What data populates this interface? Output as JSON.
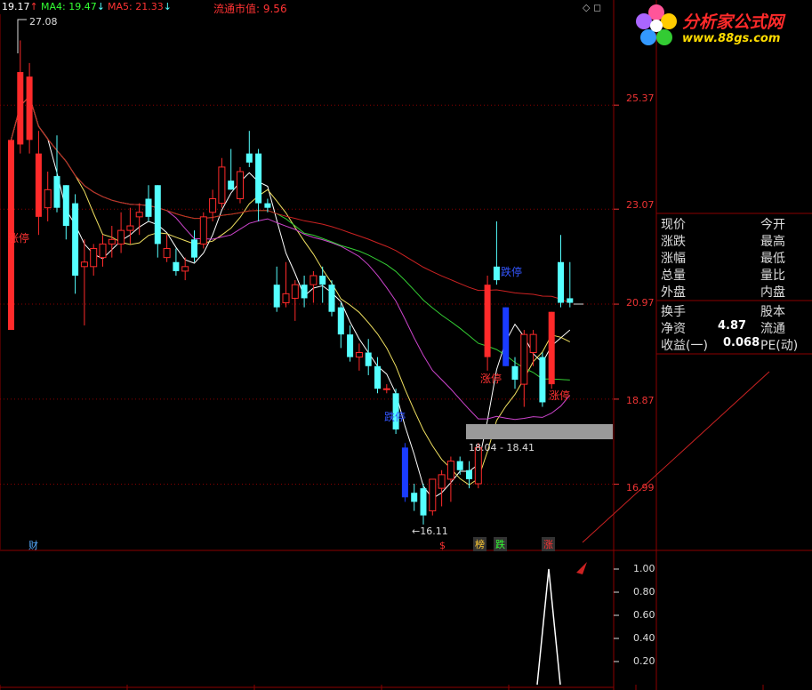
{
  "header": {
    "ma_first": "19.17",
    "ma_first_arrow": "↑",
    "ma4_label": "MA4: 19.47",
    "ma4_arrow": "↓",
    "ma5_label": "MA5: 21.33",
    "ma5_arrow": "↓",
    "market_cap_label": "流通市值: 9.56",
    "window_icons": "◇ ◻"
  },
  "logo": {
    "title": "分析家公式网",
    "url": "www.88gs.com"
  },
  "price_axis": [
    "25.37",
    "23.07",
    "20.97",
    "18.87",
    "16.99"
  ],
  "annotations": {
    "high_label": "27.08",
    "low_label": "←16.11",
    "zt_left": "涨停",
    "dt_mid": "跌停",
    "dt_right": "跌停",
    "zt_right1": "涨停",
    "zt_right2": "涨停",
    "range_label": "18.04 - 18.41",
    "cai": "财",
    "s_mark": "$",
    "bang": "榜",
    "die": "跌",
    "zhang": "涨"
  },
  "quote": {
    "rows": [
      {
        "left": "现价",
        "value": "",
        "right": "今开"
      },
      {
        "left": "涨跌",
        "value": "",
        "right": "最高"
      },
      {
        "left": "涨幅",
        "value": "",
        "right": "最低"
      },
      {
        "left": "总量",
        "value": "",
        "right": "量比"
      },
      {
        "left": "外盘",
        "value": "",
        "right": "内盘"
      },
      {
        "left": "换手",
        "value": "",
        "right": "股本"
      },
      {
        "left": "净资",
        "value": "4.87",
        "right": "流通"
      },
      {
        "left": "收益(一)",
        "value": "0.068",
        "right": "PE(动)"
      }
    ]
  },
  "sub_axis": [
    "1.00",
    "0.80",
    "0.60",
    "0.40",
    "0.20"
  ],
  "colors": {
    "up": "#ff2a2a",
    "down": "#5ff",
    "limit_down": "#1a3cff",
    "grid": "#8b0000",
    "ma_white": "#ffffff",
    "ma_yellow": "#f0e060",
    "ma_magenta": "#cc44cc",
    "ma_green": "#33cc33",
    "ma_red": "#cc2222"
  },
  "chart_data": {
    "type": "candlestick",
    "ylim": [
      15.9,
      27.3
    ],
    "candles": [
      {
        "o": 20.4,
        "h": 24.6,
        "l": 20.4,
        "c": 24.6,
        "c2": "up"
      },
      {
        "o": 24.5,
        "h": 26.8,
        "l": 24.3,
        "c": 26.1,
        "c2": "up"
      },
      {
        "o": 24.6,
        "h": 26.3,
        "l": 24.3,
        "c": 26.0,
        "c2": "up"
      },
      {
        "o": 24.3,
        "h": 24.8,
        "l": 22.5,
        "c": 22.9,
        "c2": "up"
      },
      {
        "o": 23.1,
        "h": 23.9,
        "l": 22.8,
        "c": 23.5,
        "c2": "up"
      },
      {
        "o": 23.8,
        "h": 24.7,
        "l": 23.0,
        "c": 23.1,
        "c2": "down"
      },
      {
        "o": 23.6,
        "h": 23.6,
        "l": 22.4,
        "c": 22.7,
        "c2": "down"
      },
      {
        "o": 23.2,
        "h": 23.4,
        "l": 21.2,
        "c": 21.6,
        "c2": "down"
      },
      {
        "o": 21.9,
        "h": 22.4,
        "l": 20.5,
        "c": 21.8,
        "c2": "up"
      },
      {
        "o": 21.8,
        "h": 22.3,
        "l": 21.6,
        "c": 22.2,
        "c2": "up"
      },
      {
        "o": 22.0,
        "h": 22.5,
        "l": 21.8,
        "c": 22.3,
        "c2": "up"
      },
      {
        "o": 22.3,
        "h": 22.7,
        "l": 22.0,
        "c": 22.4,
        "c2": "up"
      },
      {
        "o": 22.3,
        "h": 23.0,
        "l": 22.1,
        "c": 22.6,
        "c2": "up"
      },
      {
        "o": 22.6,
        "h": 23.1,
        "l": 22.3,
        "c": 22.7,
        "c2": "up"
      },
      {
        "o": 22.9,
        "h": 23.2,
        "l": 22.5,
        "c": 23.0,
        "c2": "up"
      },
      {
        "o": 23.3,
        "h": 23.6,
        "l": 22.8,
        "c": 22.9,
        "c2": "down"
      },
      {
        "o": 23.6,
        "h": 23.6,
        "l": 22.0,
        "c": 22.3,
        "c2": "down"
      },
      {
        "o": 22.2,
        "h": 22.5,
        "l": 21.9,
        "c": 22.0,
        "c2": "up"
      },
      {
        "o": 21.9,
        "h": 22.2,
        "l": 21.6,
        "c": 21.7,
        "c2": "down"
      },
      {
        "o": 21.7,
        "h": 22.0,
        "l": 21.5,
        "c": 21.8,
        "c2": "up"
      },
      {
        "o": 22.4,
        "h": 22.6,
        "l": 21.9,
        "c": 22.0,
        "c2": "down"
      },
      {
        "o": 22.3,
        "h": 23.0,
        "l": 22.2,
        "c": 22.9,
        "c2": "up"
      },
      {
        "o": 23.0,
        "h": 23.5,
        "l": 22.8,
        "c": 23.3,
        "c2": "up"
      },
      {
        "o": 23.2,
        "h": 24.2,
        "l": 23.1,
        "c": 24.0,
        "c2": "up"
      },
      {
        "o": 23.7,
        "h": 24.4,
        "l": 23.5,
        "c": 23.5,
        "c2": "down"
      },
      {
        "o": 23.3,
        "h": 24.0,
        "l": 23.2,
        "c": 23.9,
        "c2": "up"
      },
      {
        "o": 24.3,
        "h": 24.8,
        "l": 24.0,
        "c": 24.1,
        "c2": "down"
      },
      {
        "o": 24.3,
        "h": 24.4,
        "l": 22.8,
        "c": 23.2,
        "c2": "down"
      },
      {
        "o": 23.2,
        "h": 23.3,
        "l": 23.0,
        "c": 23.1,
        "c2": "down"
      },
      {
        "o": 21.4,
        "h": 21.8,
        "l": 20.8,
        "c": 20.9,
        "c2": "down"
      },
      {
        "o": 21.0,
        "h": 21.9,
        "l": 20.9,
        "c": 21.2,
        "c2": "up"
      },
      {
        "o": 21.1,
        "h": 21.5,
        "l": 20.6,
        "c": 21.4,
        "c2": "up"
      },
      {
        "o": 21.4,
        "h": 21.6,
        "l": 20.9,
        "c": 21.1,
        "c2": "down"
      },
      {
        "o": 21.4,
        "h": 21.7,
        "l": 21.0,
        "c": 21.6,
        "c2": "up"
      },
      {
        "o": 21.6,
        "h": 21.8,
        "l": 21.0,
        "c": 21.4,
        "c2": "down"
      },
      {
        "o": 21.4,
        "h": 21.5,
        "l": 20.7,
        "c": 20.8,
        "c2": "down"
      },
      {
        "o": 20.9,
        "h": 21.0,
        "l": 20.0,
        "c": 20.3,
        "c2": "down"
      },
      {
        "o": 20.3,
        "h": 20.5,
        "l": 19.7,
        "c": 19.8,
        "c2": "down"
      },
      {
        "o": 19.8,
        "h": 20.1,
        "l": 19.5,
        "c": 19.9,
        "c2": "up"
      },
      {
        "o": 19.9,
        "h": 20.2,
        "l": 19.4,
        "c": 19.6,
        "c2": "down"
      },
      {
        "o": 19.6,
        "h": 19.8,
        "l": 19.0,
        "c": 19.1,
        "c2": "down"
      },
      {
        "o": 19.1,
        "h": 19.2,
        "l": 19.0,
        "c": 19.1,
        "c2": "up"
      },
      {
        "o": 19.0,
        "h": 19.1,
        "l": 18.1,
        "c": 18.2,
        "c2": "down"
      },
      {
        "o": 17.8,
        "h": 17.9,
        "l": 16.6,
        "c": 16.7,
        "c2": "limitdown"
      },
      {
        "o": 16.8,
        "h": 17.0,
        "l": 16.4,
        "c": 16.6,
        "c2": "down"
      },
      {
        "o": 16.9,
        "h": 17.0,
        "l": 16.1,
        "c": 16.3,
        "c2": "down"
      },
      {
        "o": 16.4,
        "h": 17.1,
        "l": 16.3,
        "c": 17.1,
        "c2": "up"
      },
      {
        "o": 16.9,
        "h": 17.3,
        "l": 16.5,
        "c": 17.2,
        "c2": "up"
      },
      {
        "o": 17.1,
        "h": 17.6,
        "l": 16.6,
        "c": 17.5,
        "c2": "up"
      },
      {
        "o": 17.5,
        "h": 17.6,
        "l": 17.2,
        "c": 17.3,
        "c2": "down"
      },
      {
        "o": 17.3,
        "h": 17.5,
        "l": 16.9,
        "c": 17.1,
        "c2": "down"
      },
      {
        "o": 17.0,
        "h": 17.9,
        "l": 16.9,
        "c": 17.8,
        "c2": "up"
      },
      {
        "o": 19.8,
        "h": 21.6,
        "l": 19.5,
        "c": 21.4,
        "c2": "up"
      },
      {
        "o": 21.5,
        "h": 22.8,
        "l": 21.4,
        "c": 21.8,
        "c2": "down"
      },
      {
        "o": 20.9,
        "h": 20.9,
        "l": 19.6,
        "c": 19.6,
        "c2": "limitdown"
      },
      {
        "o": 19.6,
        "h": 19.8,
        "l": 19.1,
        "c": 19.3,
        "c2": "down"
      },
      {
        "o": 19.2,
        "h": 20.4,
        "l": 18.7,
        "c": 20.3,
        "c2": "up"
      },
      {
        "o": 19.9,
        "h": 20.4,
        "l": 19.6,
        "c": 20.3,
        "c2": "up"
      },
      {
        "o": 19.8,
        "h": 19.9,
        "l": 18.7,
        "c": 18.8,
        "c2": "down"
      },
      {
        "o": 19.2,
        "h": 20.8,
        "l": 19.1,
        "c": 20.8,
        "c2": "up"
      },
      {
        "o": 21.9,
        "h": 22.5,
        "l": 20.9,
        "c": 21.0,
        "c2": "down"
      },
      {
        "o": 21.1,
        "h": 21.9,
        "l": 20.9,
        "c": 21.0,
        "c2": "down"
      }
    ]
  }
}
